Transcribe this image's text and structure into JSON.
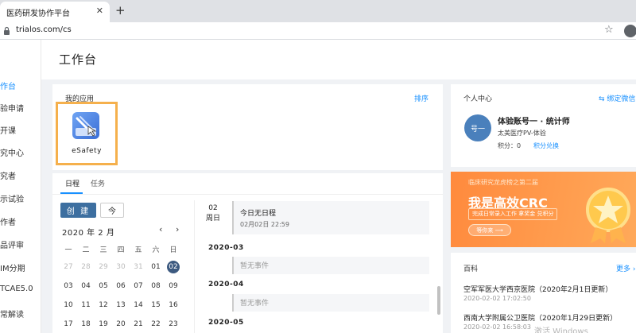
{
  "browser": {
    "tab_title": "医药研发协作平台",
    "tab_close": "✕",
    "new_tab": "+",
    "url": "trialos.com/cs",
    "star": "☆"
  },
  "sidebar": {
    "items": [
      {
        "label": "作台",
        "active": true
      },
      {
        "label": "验申请"
      },
      {
        "label": "开课"
      },
      {
        "label": "究中心"
      },
      {
        "label": "究者"
      },
      {
        "label": "示试验"
      },
      {
        "label": "作者"
      },
      {
        "label": "品评审"
      },
      {
        "label": "IM分期"
      },
      {
        "label": "TCAE5.0"
      },
      {
        "label": "常解读"
      }
    ]
  },
  "header": {
    "title": "工作台"
  },
  "apps": {
    "title": "我的应用",
    "sort_label": "排序",
    "items": [
      {
        "name": "eSafety"
      }
    ]
  },
  "schedule": {
    "tabs": [
      "日程",
      "任务"
    ],
    "create_label": "创 建",
    "today_label": "今",
    "month_label": "2020 年 2 月",
    "prev": "‹",
    "next": "›",
    "weekdays": [
      "一",
      "二",
      "三",
      "四",
      "五",
      "六",
      "日"
    ],
    "weeks": [
      [
        "27",
        "28",
        "29",
        "30",
        "31",
        "01",
        "02"
      ],
      [
        "03",
        "04",
        "05",
        "06",
        "07",
        "08",
        "09"
      ],
      [
        "10",
        "11",
        "12",
        "13",
        "14",
        "15",
        "16"
      ],
      [
        "17",
        "18",
        "19",
        "20",
        "21",
        "22",
        "23"
      ]
    ],
    "current_date": {
      "day": "02",
      "weekday": "周日",
      "event_title": "今日无日程",
      "event_time": "02月02日 22:59"
    },
    "months": [
      {
        "label": "2020-03",
        "empty_text": "暂无事件"
      },
      {
        "label": "2020-04",
        "empty_text": "暂无事件"
      },
      {
        "label": "2020-05"
      }
    ]
  },
  "personal": {
    "title": "个人中心",
    "bind_wechat": "⇆ 绑定微信",
    "avatar_text": "号一",
    "name": "体验账号一  · 统计师",
    "org": "太美医疗PV-体验",
    "points_label": "积分：0",
    "points_link": "积分兑换"
  },
  "banner": {
    "top_text": "临床研究龙虎榜之第二届",
    "main_text": "我是高效CRC",
    "sub_text": "完成日常录入工作  拿奖金  兑积分",
    "button_text": "等你来 ⟶"
  },
  "news": {
    "title": "百科",
    "more_label": "更多 ›",
    "items": [
      {
        "title": "空军军医大学西京医院（2020年2月1日更新）",
        "date": "2020-02-02 17:02:50"
      },
      {
        "title": "西南大学附属公卫医院（2020年1月29日更新）",
        "date": "2020-02-02 16:58:03"
      }
    ]
  },
  "watermark": "激活 Windows"
}
